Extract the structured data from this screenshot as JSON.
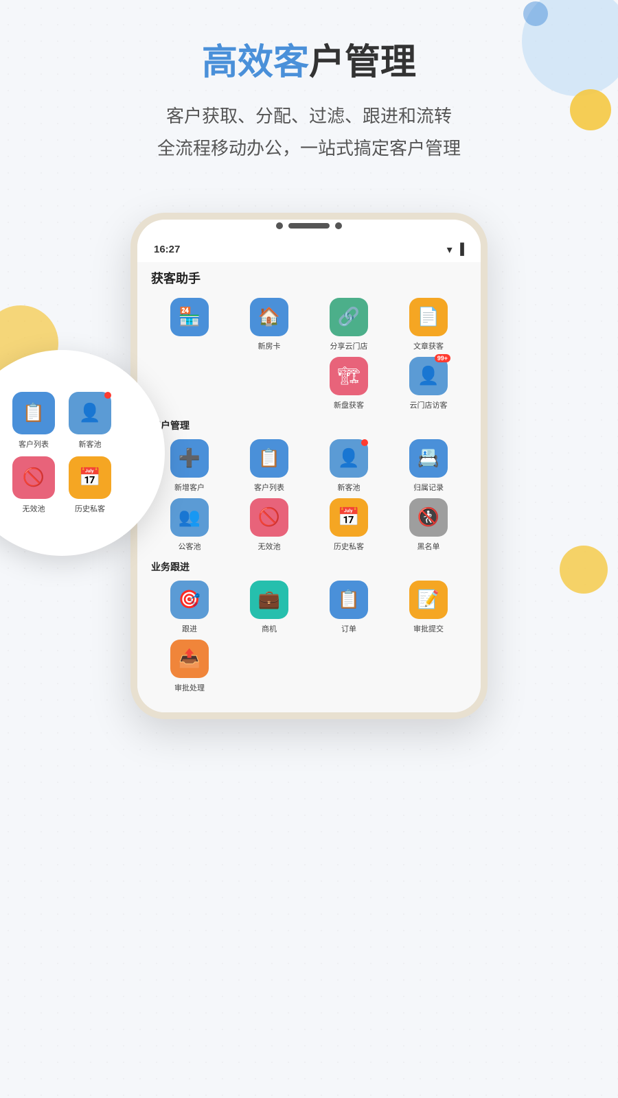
{
  "background": {
    "grid_dot_color": "#ccc"
  },
  "decorations": {
    "circle_top_right_large_color": "#b8d4f0",
    "circle_top_right_small_color": "#f5c842",
    "circle_left_color": "#f5c842",
    "circle_bottom_right_color": "#f5c842"
  },
  "hero": {
    "title_part1": "高效客",
    "title_part2": "户管理",
    "subtitle_line1": "客户获取、分配、过滤、跟进和流转",
    "subtitle_line2": "全流程移动办公，一站式搞定客户管理"
  },
  "phone": {
    "time": "16:27",
    "app_title": "获客助手",
    "section_huoke": "获客助手",
    "section_kehu": "客户管理",
    "section_yewu": "业务跟进",
    "icons_row1": [
      {
        "label": "新房卡",
        "color": "bg-blue",
        "symbol": "🏠",
        "badge": ""
      },
      {
        "label": "分享云门店",
        "color": "bg-green",
        "symbol": "🔗",
        "badge": ""
      },
      {
        "label": "文章获客",
        "color": "bg-yellow",
        "symbol": "📄",
        "badge": ""
      }
    ],
    "icons_row2": [
      {
        "label": "新盘获客",
        "color": "bg-pink",
        "symbol": "🏗",
        "badge": ""
      },
      {
        "label": "云门店访客",
        "color": "bg-blue2",
        "symbol": "👤",
        "badge": "99+"
      }
    ],
    "kehu_icons": [
      {
        "label": "新增客户",
        "color": "bg-blue",
        "symbol": "➕",
        "badge": ""
      },
      {
        "label": "客户列表",
        "color": "bg-blue",
        "symbol": "📋",
        "badge": ""
      },
      {
        "label": "新客池",
        "color": "bg-blue2",
        "symbol": "👤",
        "badge": "dot"
      },
      {
        "label": "归属记录",
        "color": "bg-blue",
        "symbol": "📇",
        "badge": ""
      },
      {
        "label": "公客池",
        "color": "bg-blue2",
        "symbol": "👥",
        "badge": ""
      },
      {
        "label": "无效池",
        "color": "bg-pink",
        "symbol": "🚫",
        "badge": ""
      },
      {
        "label": "历史私客",
        "color": "bg-yellow",
        "symbol": "📅",
        "badge": ""
      },
      {
        "label": "黑名单",
        "color": "bg-gray",
        "symbol": "🚷",
        "badge": ""
      }
    ],
    "yewu_icons": [
      {
        "label": "跟进",
        "color": "bg-blue2",
        "symbol": "🎯",
        "badge": ""
      },
      {
        "label": "商机",
        "color": "bg-teal",
        "symbol": "💼",
        "badge": ""
      },
      {
        "label": "订单",
        "color": "bg-blue",
        "symbol": "📋",
        "badge": ""
      },
      {
        "label": "审批提交",
        "color": "bg-yellow",
        "symbol": "📝",
        "badge": ""
      },
      {
        "label": "审批处理",
        "color": "bg-orange",
        "symbol": "📤",
        "badge": ""
      }
    ],
    "circle_icons": [
      {
        "label": "客户列表",
        "color": "bg-blue",
        "symbol": "📋"
      },
      {
        "label": "新客池",
        "color": "bg-blue2",
        "symbol": "👤"
      },
      {
        "label": "无效池",
        "color": "bg-pink",
        "symbol": "🚫"
      },
      {
        "label": "历史私客",
        "color": "bg-yellow",
        "symbol": "📅"
      }
    ]
  }
}
